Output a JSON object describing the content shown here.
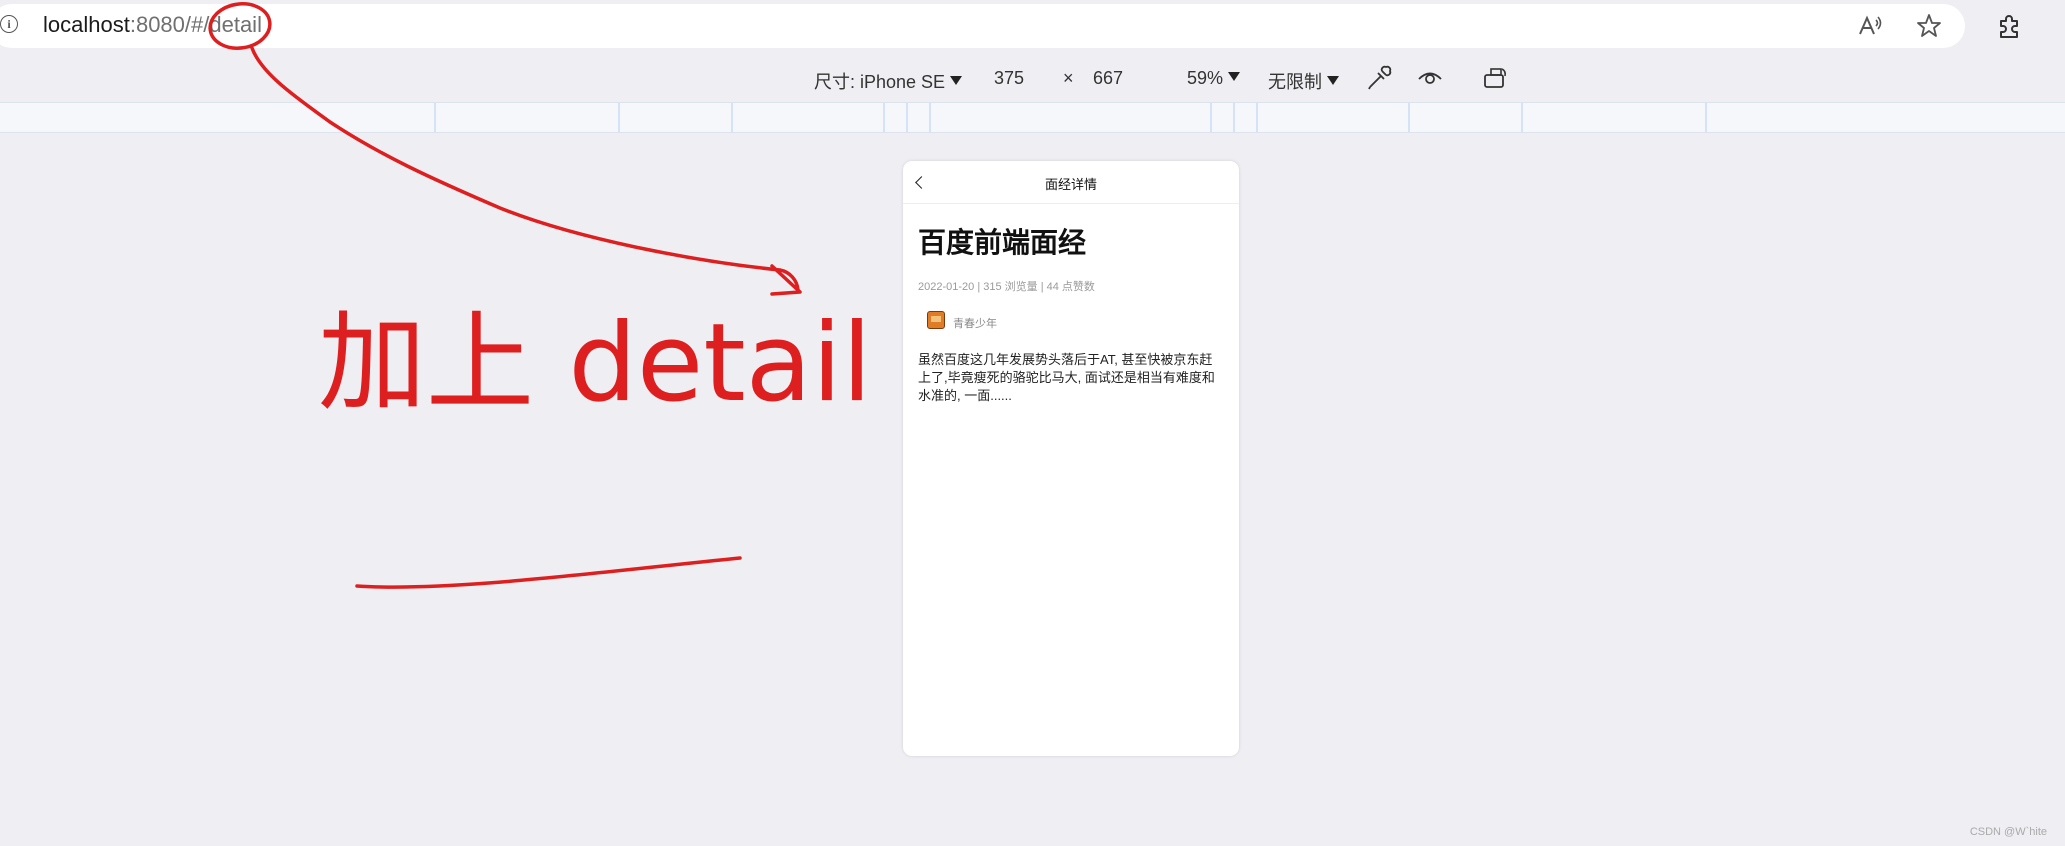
{
  "browser": {
    "url_host": "localhost",
    "url_rest": ":8080/#/detail"
  },
  "devtools": {
    "device_label": "尺寸: iPhone SE",
    "width": "375",
    "times": "×",
    "height": "667",
    "zoom": "59%",
    "throttle": "无限制"
  },
  "phone": {
    "nav_title": "面经详情",
    "article_title": "百度前端面经",
    "meta": "2022-01-20 | 315 浏览量 | 44 点赞数",
    "author": "青春少年",
    "content": "虽然百度这几年发展势头落后于AT, 甚至快被京东赶上了,毕竟瘦死的骆驼比马大, 面试还是相当有难度和水准的, 一面......"
  },
  "annotation": {
    "text": "加上 detail",
    "color": "#dd1f1f"
  },
  "watermark": "CSDN @W`hite"
}
